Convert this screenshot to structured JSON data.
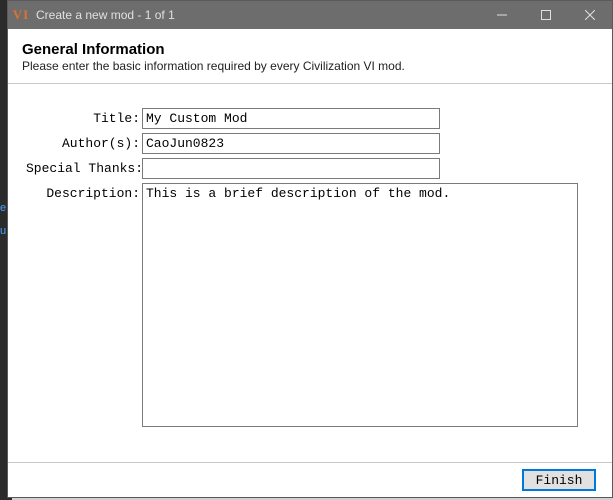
{
  "titlebar": {
    "app_icon": "VI",
    "title": "Create a new mod - 1 of 1"
  },
  "header": {
    "title": "General Information",
    "subtitle": "Please enter the basic information required by every Civilization VI mod."
  },
  "form": {
    "title_label": "Title:",
    "title_value": "My Custom Mod",
    "author_label": "Author(s):",
    "author_value": "CaoJun0823",
    "thanks_label": "Special Thanks:",
    "thanks_value": "",
    "description_label": "Description:",
    "description_value": "This is a brief description of the mod."
  },
  "buttons": {
    "finish": "Finish"
  },
  "bgstrip": {
    "t1": "e",
    "t2": "u"
  }
}
